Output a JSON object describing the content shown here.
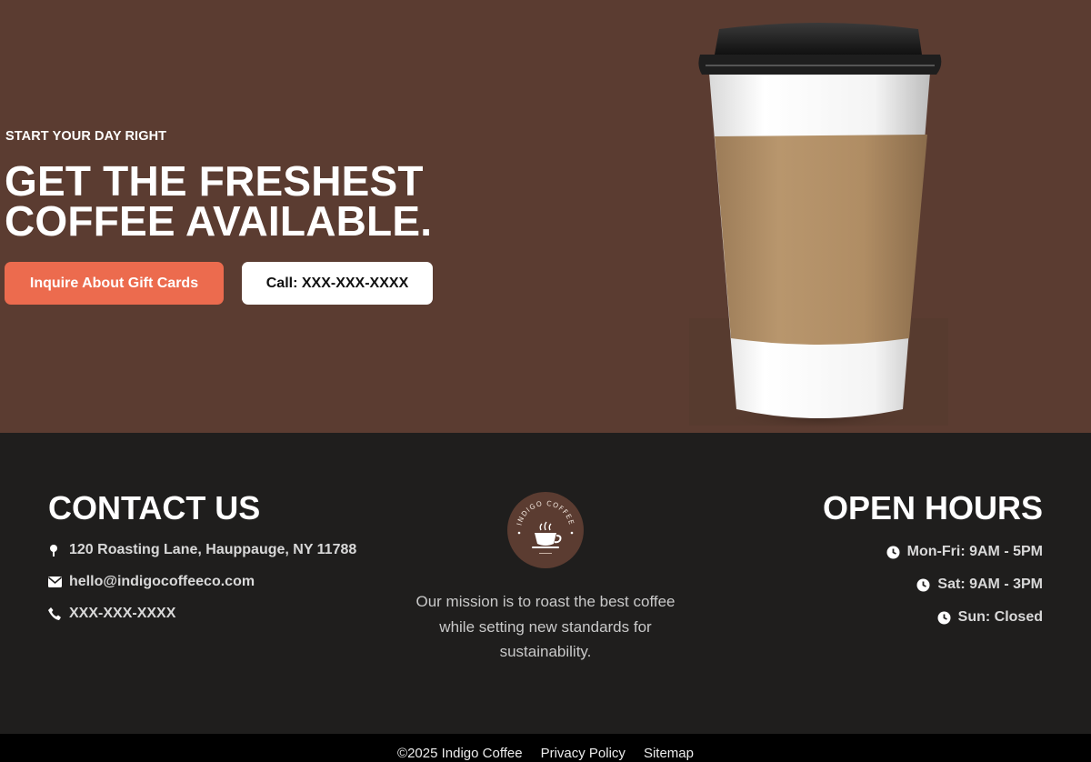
{
  "hero": {
    "eyebrow": "START YOUR DAY RIGHT",
    "title_line1": "GET THE FRESHEST",
    "title_line2": "COFFEE AVAILABLE.",
    "primary_button": "Inquire About Gift Cards",
    "secondary_button": "Call: XXX-XXX-XXXX",
    "image": "coffee-cup-image",
    "colors": {
      "background": "#5b3c31",
      "accent": "#ec6b4e"
    }
  },
  "contact": {
    "title": "CONTACT US",
    "items": [
      {
        "icon": "map-pin-icon",
        "text": "120 Roasting Lane, Hauppauge, NY 11788"
      },
      {
        "icon": "envelope-icon",
        "text": "hello@indigocoffeeco.com"
      },
      {
        "icon": "phone-icon",
        "text": "XXX-XXX-XXXX"
      }
    ]
  },
  "about": {
    "logo_text": "INDIGO COFFEE",
    "mission": "Our mission is to roast the best coffee while setting new standards for sustainability."
  },
  "hours": {
    "title": "OPEN HOURS",
    "items": [
      {
        "icon": "clock-icon",
        "text": "Mon-Fri: 9AM - 5PM"
      },
      {
        "icon": "clock-icon",
        "text": "Sat: 9AM - 3PM"
      },
      {
        "icon": "clock-icon",
        "text": "Sun: Closed"
      }
    ]
  },
  "bottom_bar": {
    "copyright": "©2025 Indigo Coffee",
    "links": [
      "Privacy Policy",
      "Sitemap"
    ]
  }
}
